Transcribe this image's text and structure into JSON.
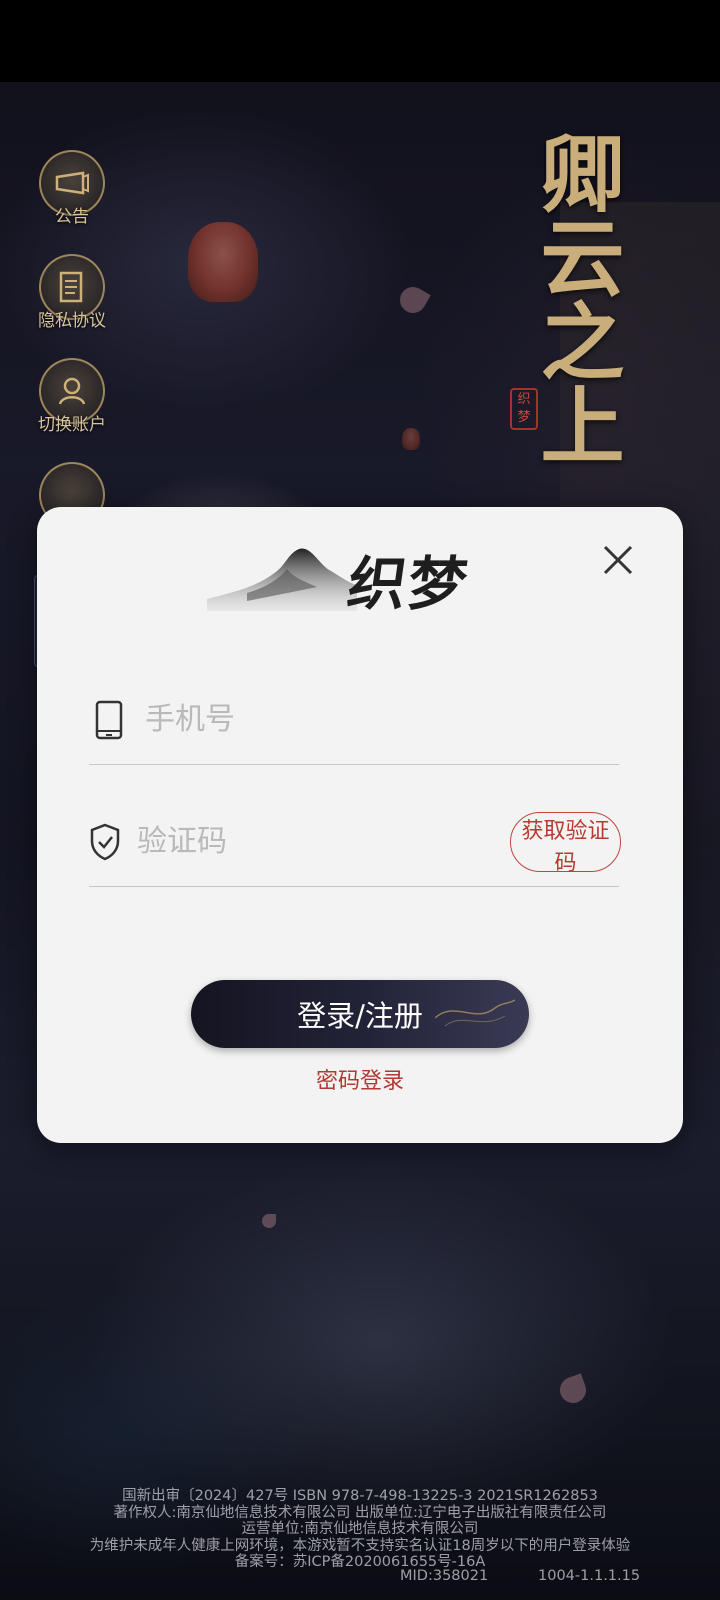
{
  "game": {
    "title": "卿云之上",
    "seal": "织梦"
  },
  "side_menu": [
    {
      "label": "公告",
      "icon": "announcement-icon"
    },
    {
      "label": "隐私协议",
      "icon": "privacy-scroll-icon"
    },
    {
      "label": "切换账户",
      "icon": "switch-account-icon"
    }
  ],
  "dialog": {
    "logo_text": "织梦",
    "phone": {
      "placeholder": "手机号",
      "value": ""
    },
    "code": {
      "placeholder": "验证码",
      "value": ""
    },
    "get_code_label": "获取验证码",
    "login_label": "登录/注册",
    "password_login_label": "密码登录"
  },
  "footer": {
    "lines": [
      "国新出审〔2024〕427号 ISBN 978-7-498-13225-3 2021SR1262853",
      "著作权人:南京仙地信息技术有限公司 出版单位:辽宁电子出版社有限责任公司",
      "运营单位:南京仙地信息技术有限公司",
      "为维护未成年人健康上网环境，本游戏暂不支持实名认证18周岁以下的用户登录体验",
      "备案号：苏ICP备2020061655号-16A"
    ],
    "mid": "MID:358021",
    "version": "1004-1.1.1.15"
  },
  "colors": {
    "accent_red": "#b93a32",
    "title_gold": "#c9ae7c",
    "dialog_bg": "#f3f3f3"
  }
}
